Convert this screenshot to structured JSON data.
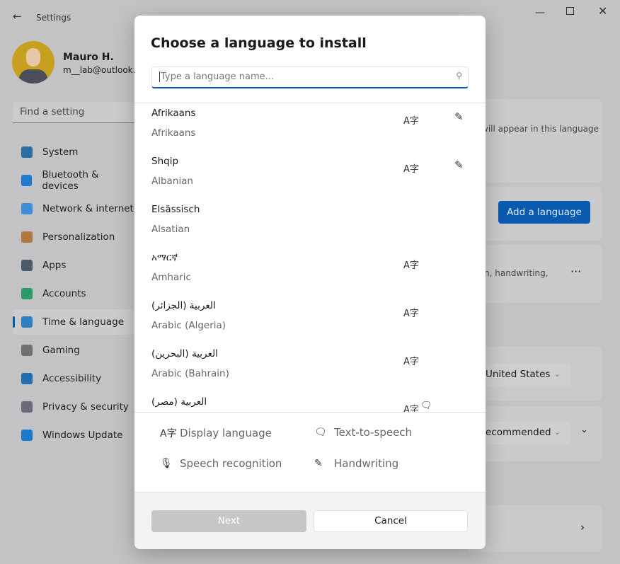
{
  "window": {
    "title": "Settings"
  },
  "user": {
    "name": "Mauro H.",
    "email": "m__lab@outlook.com"
  },
  "search": {
    "placeholder": "Find a setting"
  },
  "sidebar": {
    "items": [
      {
        "label": "System",
        "icon": "system-icon",
        "color": "#2a6ea6"
      },
      {
        "label": "Bluetooth & devices",
        "icon": "bluetooth-icon",
        "color": "#1f7ad1"
      },
      {
        "label": "Network & internet",
        "icon": "wifi-icon",
        "color": "#3a8fd8"
      },
      {
        "label": "Personalization",
        "icon": "brush-icon",
        "color": "#b07840"
      },
      {
        "label": "Apps",
        "icon": "apps-icon",
        "color": "#4a5a6a"
      },
      {
        "label": "Accounts",
        "icon": "accounts-icon",
        "color": "#2a9a6a"
      },
      {
        "label": "Time & language",
        "icon": "globe-clock-icon",
        "color": "#2a80c0",
        "active": true
      },
      {
        "label": "Gaming",
        "icon": "gamepad-icon",
        "color": "#707070"
      },
      {
        "label": "Accessibility",
        "icon": "accessibility-icon",
        "color": "#1f6fb0"
      },
      {
        "label": "Privacy & security",
        "icon": "shield-icon",
        "color": "#6a6a7a"
      },
      {
        "label": "Windows Update",
        "icon": "update-icon",
        "color": "#1a7ad0"
      }
    ]
  },
  "background": {
    "display_hint": "will appear in this language",
    "add_language": "Add a language",
    "features_hint": "n, handwriting,",
    "region": "United States",
    "format": "ecommended",
    "accent": "#0a5ab0"
  },
  "dialog": {
    "title": "Choose a language to install",
    "search_placeholder": "Type a language name...",
    "languages": [
      {
        "native": "Afrikaans",
        "english": "Afrikaans",
        "display": true,
        "handwriting": true,
        "tts": false
      },
      {
        "native": "Shqip",
        "english": "Albanian",
        "display": true,
        "handwriting": true,
        "tts": false
      },
      {
        "native": "Elsässisch",
        "english": "Alsatian",
        "display": false,
        "handwriting": false,
        "tts": false
      },
      {
        "native": "አማርኛ",
        "english": "Amharic",
        "display": true,
        "handwriting": false,
        "tts": false
      },
      {
        "native": "العربية (الجزائر)",
        "english": "Arabic (Algeria)",
        "display": true,
        "handwriting": false,
        "tts": false
      },
      {
        "native": "العربية (البحرين)",
        "english": "Arabic (Bahrain)",
        "display": true,
        "handwriting": false,
        "tts": false
      },
      {
        "native": "العربية (مصر)",
        "english": "",
        "display": true,
        "handwriting": false,
        "tts": true
      }
    ],
    "legend": {
      "display": "Display language",
      "tts": "Text-to-speech",
      "speech": "Speech recognition",
      "handwriting": "Handwriting"
    },
    "next": "Next",
    "cancel": "Cancel"
  }
}
